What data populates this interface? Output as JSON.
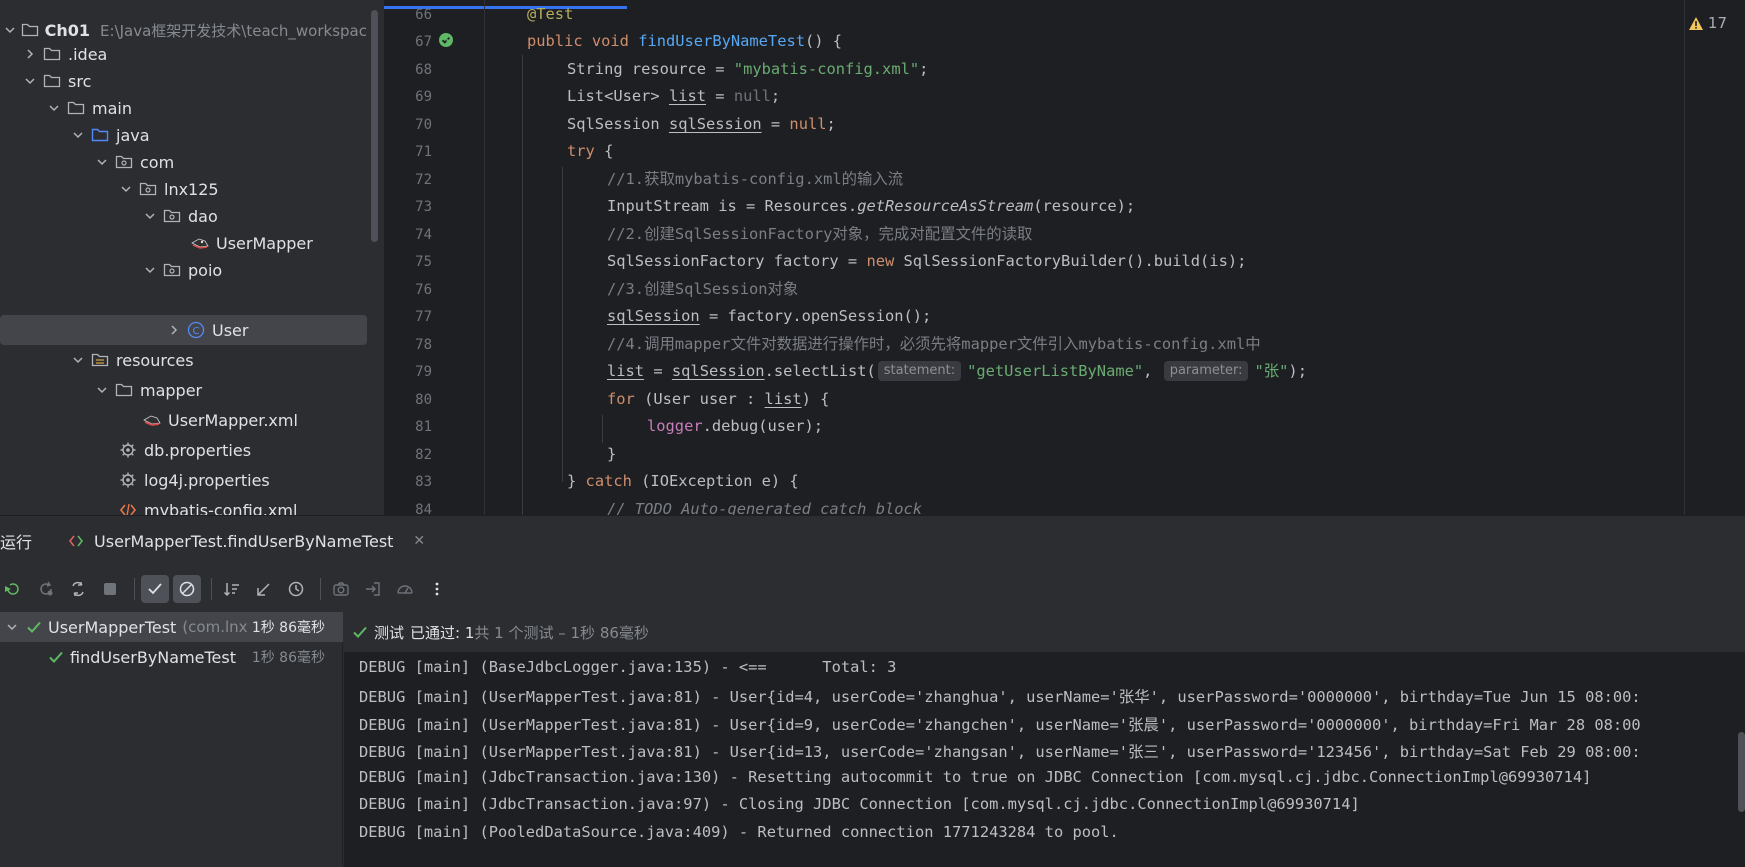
{
  "project": {
    "root_name": "Ch01",
    "root_path": "E:\\Java框架开发技术\\teach_workspac",
    "items": [
      {
        "label": "Ch01",
        "icon": "folder-icon"
      },
      {
        "label": ".idea",
        "icon": "folder-icon"
      },
      {
        "label": "src",
        "icon": "folder-icon"
      },
      {
        "label": "main",
        "icon": "folder-icon"
      },
      {
        "label": "java",
        "icon": "source-folder-icon"
      },
      {
        "label": "com",
        "icon": "package-icon"
      },
      {
        "label": "lnx125",
        "icon": "package-icon"
      },
      {
        "label": "dao",
        "icon": "package-icon"
      },
      {
        "label": "UserMapper",
        "icon": "mybatis-interface-icon"
      },
      {
        "label": "poio",
        "icon": "package-icon"
      },
      {
        "label": "User",
        "icon": "class-icon"
      },
      {
        "label": "resources",
        "icon": "resources-folder-icon"
      },
      {
        "label": "mapper",
        "icon": "folder-icon"
      },
      {
        "label": "UserMapper.xml",
        "icon": "mybatis-xml-icon"
      },
      {
        "label": "db.properties",
        "icon": "properties-icon"
      },
      {
        "label": "log4j.properties",
        "icon": "properties-icon"
      },
      {
        "label": "mybatis-config.xml",
        "icon": "xml-icon"
      }
    ]
  },
  "editor": {
    "warning_count": "17",
    "line_numbers": [
      "66",
      "67",
      "68",
      "69",
      "70",
      "71",
      "72",
      "73",
      "74",
      "75",
      "76",
      "77",
      "78",
      "79",
      "80",
      "81",
      "82",
      "83",
      "84"
    ],
    "lines": {
      "l66": "@Test",
      "l67_a": "public void ",
      "l67_b": "findUserByNameTest",
      "l67_c": "() {",
      "l68_a": "String resource = ",
      "l68_b": "\"mybatis-config.xml\"",
      "l68_c": ";",
      "l69_a": "List<User> ",
      "l69_b": "list",
      "l69_c": " = ",
      "l69_d": "null",
      "l69_e": ";",
      "l70_a": "SqlSession ",
      "l70_b": "sqlSession",
      "l70_c": " = ",
      "l70_d": "null",
      "l70_e": ";",
      "l71_a": "try",
      "l71_b": " {",
      "l72": "//1.获取mybatis-config.xml的输入流",
      "l73_a": "InputStream is = Resources.",
      "l73_b": "getResourceAsStream",
      "l73_c": "(resource);",
      "l74": "//2.创建SqlSessionFactory对象，完成对配置文件的读取",
      "l75_a": "SqlSessionFactory factory = ",
      "l75_b": "new",
      "l75_c": " SqlSessionFactoryBuilder().build(is);",
      "l76": "//3.创建SqlSession对象",
      "l77_a": "sqlSession",
      "l77_b": " = factory.openSession();",
      "l78": "//4.调用mapper文件对数据进行操作时，必须先将mapper文件引入mybatis-config.xml中",
      "l79_a": "list",
      "l79_b": " = ",
      "l79_c": "sqlSession",
      "l79_d": ".selectList(",
      "l79_hint1": "statement:",
      "l79_e": "\"getUserListByName\"",
      "l79_f": ", ",
      "l79_hint2": "parameter:",
      "l79_g": "\"张\"",
      "l79_h": ");",
      "l80_a": "for",
      "l80_b": " (User user : ",
      "l80_c": "list",
      "l80_d": ") {",
      "l81_a": "logger",
      "l81_b": ".debug(user);",
      "l82": "}",
      "l83_a": "} ",
      "l83_b": "catch",
      "l83_c": " (IOException e) {",
      "l84": "// TODO Auto-generated catch block"
    }
  },
  "run_panel": {
    "title": "运行",
    "tab_label": "UserMapperTest.findUserByNameTest",
    "status_prefix": "测试",
    "status_passed": "已通过: 1",
    "status_rest": "共 1 个测试 – 1秒 86毫秒",
    "tests": [
      {
        "name": "UserMapperTest",
        "pkg": "(com.lnx",
        "time": "1秒 86毫秒"
      },
      {
        "name": "findUserByNameTest",
        "pkg": "",
        "time": "1秒 86毫秒"
      }
    ],
    "log": [
      "DEBUG [main] (BaseJdbcLogger.java:135) - <==      Total: 3",
      "DEBUG [main] (UserMapperTest.java:81) - User{id=4, userCode='zhanghua', userName='张华', userPassword='0000000', birthday=Tue Jun 15 08:00:",
      "DEBUG [main] (UserMapperTest.java:81) - User{id=9, userCode='zhangchen', userName='张晨', userPassword='0000000', birthday=Fri Mar 28 08:00",
      "DEBUG [main] (UserMapperTest.java:81) - User{id=13, userCode='zhangsan', userName='张三', userPassword='123456', birthday=Sat Feb 29 08:00:",
      "DEBUG [main] (JdbcTransaction.java:130) - Resetting autocommit to true on JDBC Connection [com.mysql.cj.jdbc.ConnectionImpl@69930714]",
      "DEBUG [main] (JdbcTransaction.java:97) - Closing JDBC Connection [com.mysql.cj.jdbc.ConnectionImpl@69930714]",
      "DEBUG [main] (PooledDataSource.java:409) - Returned connection 1771243284 to pool."
    ]
  },
  "colors": {
    "accent": "#3574f0",
    "pass_green": "#5fb865",
    "keyword": "#cf8e6d",
    "string": "#6aab73"
  }
}
